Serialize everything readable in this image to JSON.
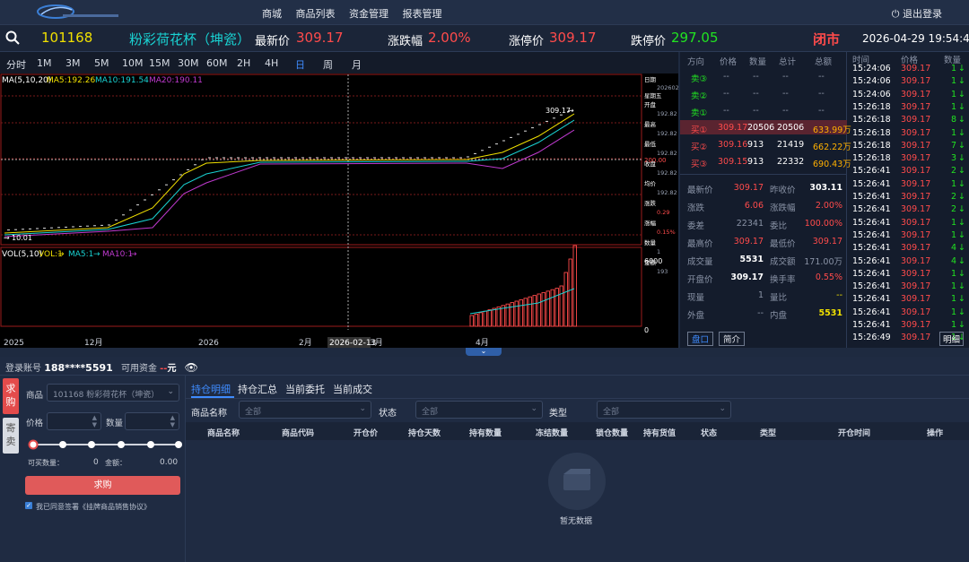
{
  "nav": {
    "menu": [
      "商城",
      "商品列表",
      "资金管理",
      "报表管理"
    ],
    "logout": "退出登录"
  },
  "quote": {
    "code": "101168",
    "name": "粉彩荷花杯（坤瓷）",
    "last_label": "最新价",
    "last": "309.17",
    "chg_label": "涨跌幅",
    "chg": "2.00%",
    "up_label": "涨停价",
    "up": "309.17",
    "down_label": "跌停价",
    "down": "297.05",
    "status": "闭市",
    "datetime": "2026-04-29 19:54:45"
  },
  "periods": [
    "分时",
    "1M",
    "3M",
    "5M",
    "10M",
    "15M",
    "30M",
    "60M",
    "2H",
    "4H",
    "日",
    "周",
    "月"
  ],
  "chart": {
    "ma_label": "MA(5,10,20)",
    "ma5": "MA5:192.26",
    "ma10": "MA10:191.54",
    "ma20": "MA20:190.11",
    "vol_label": "VOL(5,10)",
    "vol1": "VOL:1",
    "vma5": "MA5:1",
    "vma10": "MA10:1",
    "price_last": "309.17",
    "price_low": "10.01",
    "vol_max": "6000",
    "vol_zero": "0",
    "x_labels": [
      "2025",
      "12月",
      "2026",
      "2月",
      "2026-02-13",
      "3月",
      "4月"
    ],
    "info_panel": [
      "日期",
      "20260213",
      "星期五",
      "开盘",
      "192.82",
      "最高",
      "192.82",
      "最低",
      "192.82",
      "收盘",
      "192.82",
      "均价",
      "192.82",
      "涨跌",
      "0.29",
      "涨幅",
      "0.15%",
      "数量",
      "1",
      "金额",
      "193"
    ],
    "right_axis": [
      "200.00"
    ],
    "arrow": "→"
  },
  "book": {
    "headers": [
      "方向",
      "价格",
      "数量",
      "总计",
      "总额"
    ],
    "asks": [
      {
        "dir": "卖③",
        "p": "--",
        "q": "--",
        "t": "--",
        "a": "--"
      },
      {
        "dir": "卖②",
        "p": "--",
        "q": "--",
        "t": "--",
        "a": "--"
      },
      {
        "dir": "卖①",
        "p": "--",
        "q": "--",
        "t": "--",
        "a": "--"
      }
    ],
    "bids": [
      {
        "dir": "买①",
        "p": "309.17",
        "q": "20506",
        "t": "20506",
        "a": "633.99万"
      },
      {
        "dir": "买②",
        "p": "309.16",
        "q": "913",
        "t": "21419",
        "a": "662.22万"
      },
      {
        "dir": "买③",
        "p": "309.15",
        "q": "913",
        "t": "22332",
        "a": "690.43万"
      }
    ]
  },
  "stats": [
    [
      "最新价",
      "309.17",
      "昨收价",
      "303.11"
    ],
    [
      "涨跌",
      "6.06",
      "涨跌幅",
      "2.00%"
    ],
    [
      "委差",
      "22341",
      "委比",
      "100.00%"
    ],
    [
      "最高价",
      "309.17",
      "最低价",
      "309.17"
    ],
    [
      "成交量",
      "5531",
      "成交额",
      "171.00万"
    ],
    [
      "开盘价",
      "309.17",
      "换手率",
      "0.55%"
    ],
    [
      "现量",
      "1",
      "量比",
      "--"
    ],
    [
      "外盘",
      "--",
      "内盘",
      "5531"
    ]
  ],
  "stat_btns": [
    "盘口",
    "简介"
  ],
  "trades": {
    "headers": [
      "时间",
      "价格",
      "数量"
    ],
    "detail_btn": "明细",
    "rows": [
      [
        "15:24:06",
        "309.17",
        "1"
      ],
      [
        "15:24:06",
        "309.17",
        "1"
      ],
      [
        "15:24:06",
        "309.17",
        "1"
      ],
      [
        "15:26:18",
        "309.17",
        "1"
      ],
      [
        "15:26:18",
        "309.17",
        "8"
      ],
      [
        "15:26:18",
        "309.17",
        "1"
      ],
      [
        "15:26:18",
        "309.17",
        "7"
      ],
      [
        "15:26:18",
        "309.17",
        "3"
      ],
      [
        "15:26:41",
        "309.17",
        "2"
      ],
      [
        "15:26:41",
        "309.17",
        "1"
      ],
      [
        "15:26:41",
        "309.17",
        "2"
      ],
      [
        "15:26:41",
        "309.17",
        "2"
      ],
      [
        "15:26:41",
        "309.17",
        "1"
      ],
      [
        "15:26:41",
        "309.17",
        "1"
      ],
      [
        "15:26:41",
        "309.17",
        "4"
      ],
      [
        "15:26:41",
        "309.17",
        "4"
      ],
      [
        "15:26:41",
        "309.17",
        "1"
      ],
      [
        "15:26:41",
        "309.17",
        "1"
      ],
      [
        "15:26:41",
        "309.17",
        "1"
      ],
      [
        "15:26:41",
        "309.17",
        "1"
      ],
      [
        "15:26:41",
        "309.17",
        "1"
      ],
      [
        "15:26:49",
        "309.17",
        "1"
      ]
    ],
    "arrow": "↓"
  },
  "account": {
    "label": "登录账号",
    "value": "188****5591",
    "funds_label": "可用资金",
    "funds": "--",
    "unit": "元"
  },
  "order": {
    "tab_buy": "求购",
    "tab_sell": "寄卖",
    "product_label": "商品",
    "product": "101168 粉彩荷花杯（坤瓷）",
    "price_label": "价格",
    "qty_label": "数量",
    "buyable_label": "可买数量：",
    "buyable": "0",
    "amount_label": "金额：",
    "amount": "0.00",
    "submit": "求购",
    "agree": "我已同意签署《挂牌商品销售协议》"
  },
  "positions": {
    "tabs": [
      "持仓明细",
      "持仓汇总",
      "当前委托",
      "当前成交"
    ],
    "filter_name": "商品名称",
    "filter_status": "状态",
    "filter_type": "类型",
    "all": "全部",
    "columns": [
      "商品名称",
      "商品代码",
      "开仓价",
      "持仓天数",
      "持有数量",
      "冻结数量",
      "锁仓数量",
      "持有货值",
      "状态",
      "类型",
      "开仓时间",
      "操作"
    ],
    "empty": "暂无数据"
  }
}
